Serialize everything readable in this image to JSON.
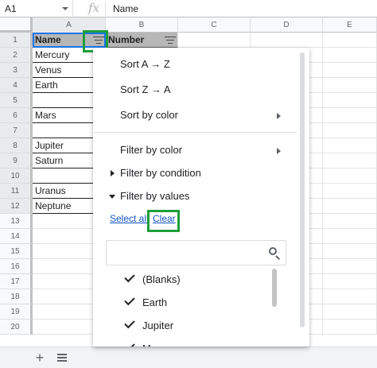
{
  "formula_bar": {
    "cell_ref": "A1",
    "fx_symbol": "fx",
    "content": "Name"
  },
  "columns": [
    "A",
    "B",
    "C",
    "D",
    "E"
  ],
  "rows": [
    {
      "num": "1",
      "a": "Name",
      "b": "Number"
    },
    {
      "num": "2",
      "a": "Mercury",
      "b": ""
    },
    {
      "num": "3",
      "a": "Venus",
      "b": ""
    },
    {
      "num": "4",
      "a": "Earth",
      "b": ""
    },
    {
      "num": "5",
      "a": "",
      "b": ""
    },
    {
      "num": "6",
      "a": "Mars",
      "b": ""
    },
    {
      "num": "7",
      "a": "",
      "b": ""
    },
    {
      "num": "8",
      "a": "Jupiter",
      "b": ""
    },
    {
      "num": "9",
      "a": "Saturn",
      "b": ""
    },
    {
      "num": "10",
      "a": "",
      "b": ""
    },
    {
      "num": "11",
      "a": "Uranus",
      "b": ""
    },
    {
      "num": "12",
      "a": "Neptune",
      "b": ""
    },
    {
      "num": "13",
      "a": "",
      "b": ""
    },
    {
      "num": "14",
      "a": "",
      "b": ""
    },
    {
      "num": "15",
      "a": "",
      "b": ""
    },
    {
      "num": "16",
      "a": "",
      "b": ""
    },
    {
      "num": "17",
      "a": "",
      "b": ""
    },
    {
      "num": "18",
      "a": "",
      "b": ""
    },
    {
      "num": "19",
      "a": "",
      "b": ""
    },
    {
      "num": "20",
      "a": "",
      "b": ""
    }
  ],
  "sheet_bar": {
    "add_label": "+"
  },
  "menu": {
    "sort_az": "Sort A → Z",
    "sort_za": "Sort Z → A",
    "sort_color": "Sort by color",
    "filter_color": "Filter by color",
    "filter_condition": "Filter by condition",
    "filter_values": "Filter by values",
    "select_all": "Select all",
    "clear": "Clear",
    "search_placeholder": "",
    "values": [
      "(Blanks)",
      "Earth",
      "Jupiter",
      "Mars"
    ]
  },
  "colors": {
    "highlight": "#1e9e3a",
    "header_fill": "#b7b7b7",
    "link": "#1155cc"
  }
}
